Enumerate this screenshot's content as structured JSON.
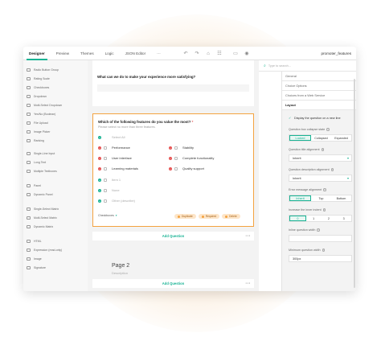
{
  "toolbar": {
    "tabs": [
      "Designer",
      "Preview",
      "Themes",
      "Logic",
      "JSON Editor"
    ],
    "more": "···",
    "survey_name": "promoter_features"
  },
  "search": {
    "placeholder": "Type to search..."
  },
  "toolbox": {
    "items": [
      "Radio Button Group",
      "Rating Scale",
      "Checkboxes",
      "Dropdown",
      "Multi-Select Dropdown",
      "Yes/No (Boolean)",
      "File Upload",
      "Image Picker",
      "Ranking",
      "Single-Line Input",
      "Long Text",
      "Multiple Textboxes",
      "Panel",
      "Dynamic Panel",
      "Single-Select Matrix",
      "Multi-Select Matrix",
      "Dynamic Matrix",
      "HTML",
      "Expression (read-only)",
      "Image",
      "Signature"
    ]
  },
  "canvas": {
    "q1_title": "What can we do to make your experience more satisfying?",
    "q2_title": "Which of the following features do you value the most?",
    "required_mark": "*",
    "q2_desc": "Please select no more than three features.",
    "select_all": "Select All",
    "options_left": [
      "Performance",
      "User interface",
      "Learning materials"
    ],
    "options_right": [
      "Stability",
      "Complete functionality",
      "Quality support"
    ],
    "item1": "Item 1",
    "none": "None",
    "other": "Other (describe)",
    "type_label": "Checkboxes",
    "duplicate": "Duplicate",
    "required": "Required",
    "delete": "Delete",
    "add_question": "Add Question",
    "page2_title": "Page 2",
    "page2_desc": "Description"
  },
  "props": {
    "categories": [
      "General",
      "Choice Options",
      "Choices from a Web Service"
    ],
    "layout": "Layout",
    "display_on_new_line": "Display the question on a new line",
    "collapse_label": "Question box collapse state",
    "collapse_opts": [
      "Locked",
      "Collapsed",
      "Expanded"
    ],
    "title_align_label": "Question title alignment",
    "title_align_value": "Inherit",
    "desc_align_label": "Question description alignment",
    "desc_align_value": "Inherit",
    "error_align_label": "Error message alignment",
    "error_align_opts": [
      "Inherit",
      "Top",
      "Bottom"
    ],
    "indent_label": "Increase the inner indent",
    "indent_opts": [
      "0",
      "1",
      "2",
      "3"
    ],
    "width_label": "Inline question width",
    "min_width_label": "Minimum question width",
    "min_width_value": "300px"
  },
  "colors": {
    "accent": "#19b394",
    "selection": "#f4a340",
    "danger": "#e75353"
  }
}
